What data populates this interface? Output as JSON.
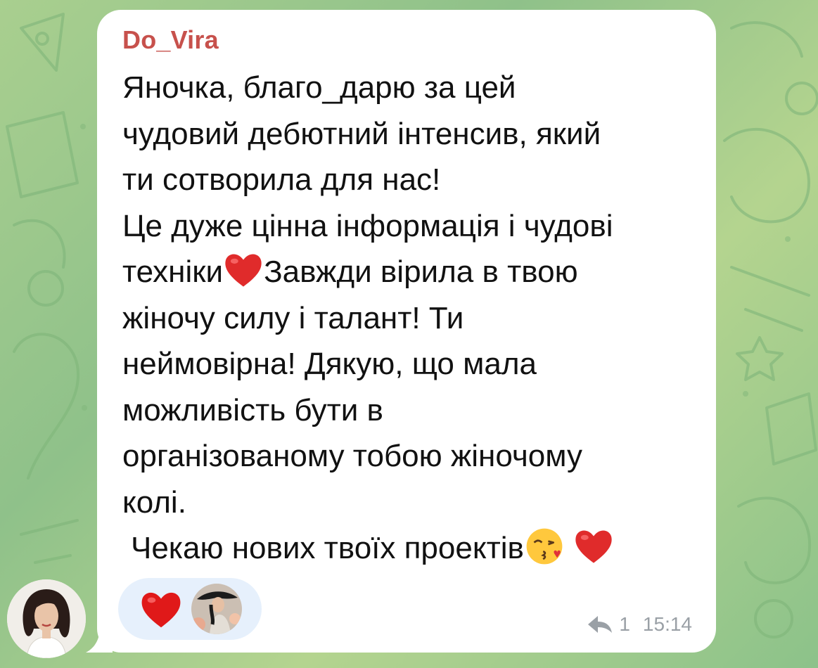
{
  "background": {
    "color_top_left": "#a9cf8f",
    "color_bottom_right": "#8cc28a",
    "pattern": "doodle-pattern"
  },
  "message": {
    "sender": "Do_Vira",
    "sender_color": "#c7514c",
    "lines": [
      "Яночка, благо_дарю за цей",
      "чудовий дебютний інтенсив, який",
      "ти сотворила для нас!",
      "Це дуже цінна інформація і чудові",
      "техніки",
      "Завжди вірила в твою",
      "жіночу силу і талант! Ти",
      "неймовірна! Дякую, що мала",
      "можливість бути в",
      "організованому тобою жіночому",
      "колі.",
      "Чекаю нових твоїх проектів"
    ],
    "inline_emojis": [
      "red-heart-emoji",
      "kissing-face-emoji",
      "red-heart-emoji"
    ]
  },
  "reaction": {
    "emoji": "red-heart-emoji",
    "reactor_avatar": "reactor-avatar"
  },
  "meta": {
    "reply_icon": "reply-arrow-icon",
    "reply_count": "1",
    "time": "15:14"
  },
  "sender_avatar": "sender-avatar"
}
